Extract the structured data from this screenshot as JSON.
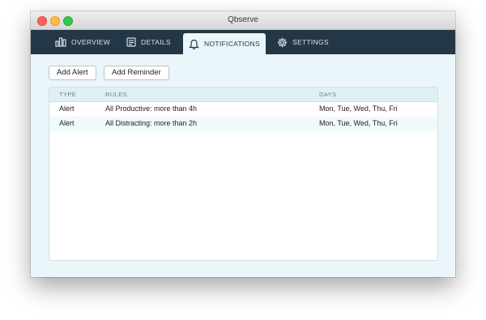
{
  "window": {
    "title": "Qbserve"
  },
  "tabs": [
    {
      "label": "OVERVIEW",
      "icon": "bar-chart-icon",
      "active": false
    },
    {
      "label": "DETAILS",
      "icon": "list-icon",
      "active": false
    },
    {
      "label": "NOTIFICATIONS",
      "icon": "bell-icon",
      "active": true
    },
    {
      "label": "SETTINGS",
      "icon": "gear-icon",
      "active": false
    }
  ],
  "toolbar": {
    "add_alert": "Add Alert",
    "add_reminder": "Add Reminder"
  },
  "table": {
    "columns": [
      "TYPE",
      "RULES",
      "DAYS"
    ],
    "rows": [
      {
        "type": "Alert",
        "rule": "All Productive: more than 4h",
        "days": "Mon, Tue, Wed, Thu, Fri"
      },
      {
        "type": "Alert",
        "rule": "All Distracting: more than 2h",
        "days": "Mon, Tue, Wed, Thu, Fri"
      }
    ]
  },
  "colors": {
    "tabbar": "#243746",
    "content_bg": "#eaf6fa",
    "header_bg": "#dff0f4"
  }
}
